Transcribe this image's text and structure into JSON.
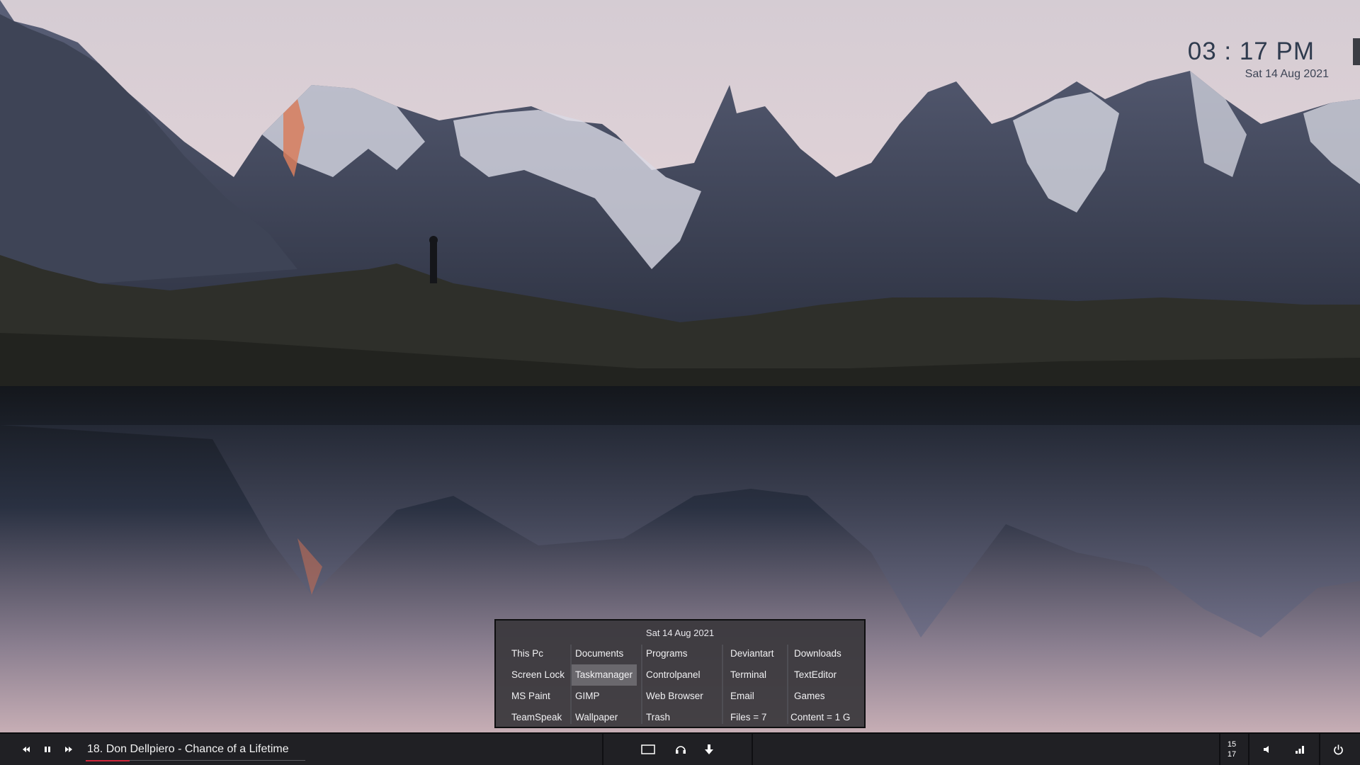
{
  "wallpaper": {
    "description_colors": {
      "sky_top": "#d9d1d6",
      "sky_mid": "#e6d6d9",
      "mountain": "#4a5168",
      "snow": "#dcdde6",
      "ground": "#2e2f2a",
      "water": "#1f2430"
    }
  },
  "clock": {
    "time": "03 : 17 PM",
    "date": "Sat 14 Aug 2021"
  },
  "launcher": {
    "date": "Sat 14 Aug 2021",
    "columns": [
      [
        "This Pc",
        "Screen Lock",
        "MS Paint",
        "TeamSpeak"
      ],
      [
        "Documents",
        "Taskmanager",
        "GIMP",
        "Wallpaper"
      ],
      [
        "Programs",
        "Controlpanel",
        "Web Browser",
        "Trash"
      ],
      [
        "Deviantart",
        "Terminal",
        "Email",
        "Files = 7"
      ],
      [
        "Downloads",
        "TextEditor",
        "Games",
        "Content = 1 G"
      ]
    ],
    "active_item": "Taskmanager"
  },
  "taskbar": {
    "media": {
      "prev_icon": "rewind-icon",
      "pause_icon": "pause-icon",
      "next_icon": "fast-forward-icon",
      "track": "18. Don Dellpiero - Chance of a Lifetime",
      "progress": 0.2
    },
    "center_icons": [
      "window-icon",
      "headphones-icon",
      "download-arrow-icon"
    ],
    "tray": {
      "clock_hour": "15",
      "clock_min": "17",
      "volume_icon": "speaker-icon",
      "signal_icon": "signal-bars-icon",
      "power_icon": "power-icon"
    },
    "accent": "#d0263a"
  }
}
